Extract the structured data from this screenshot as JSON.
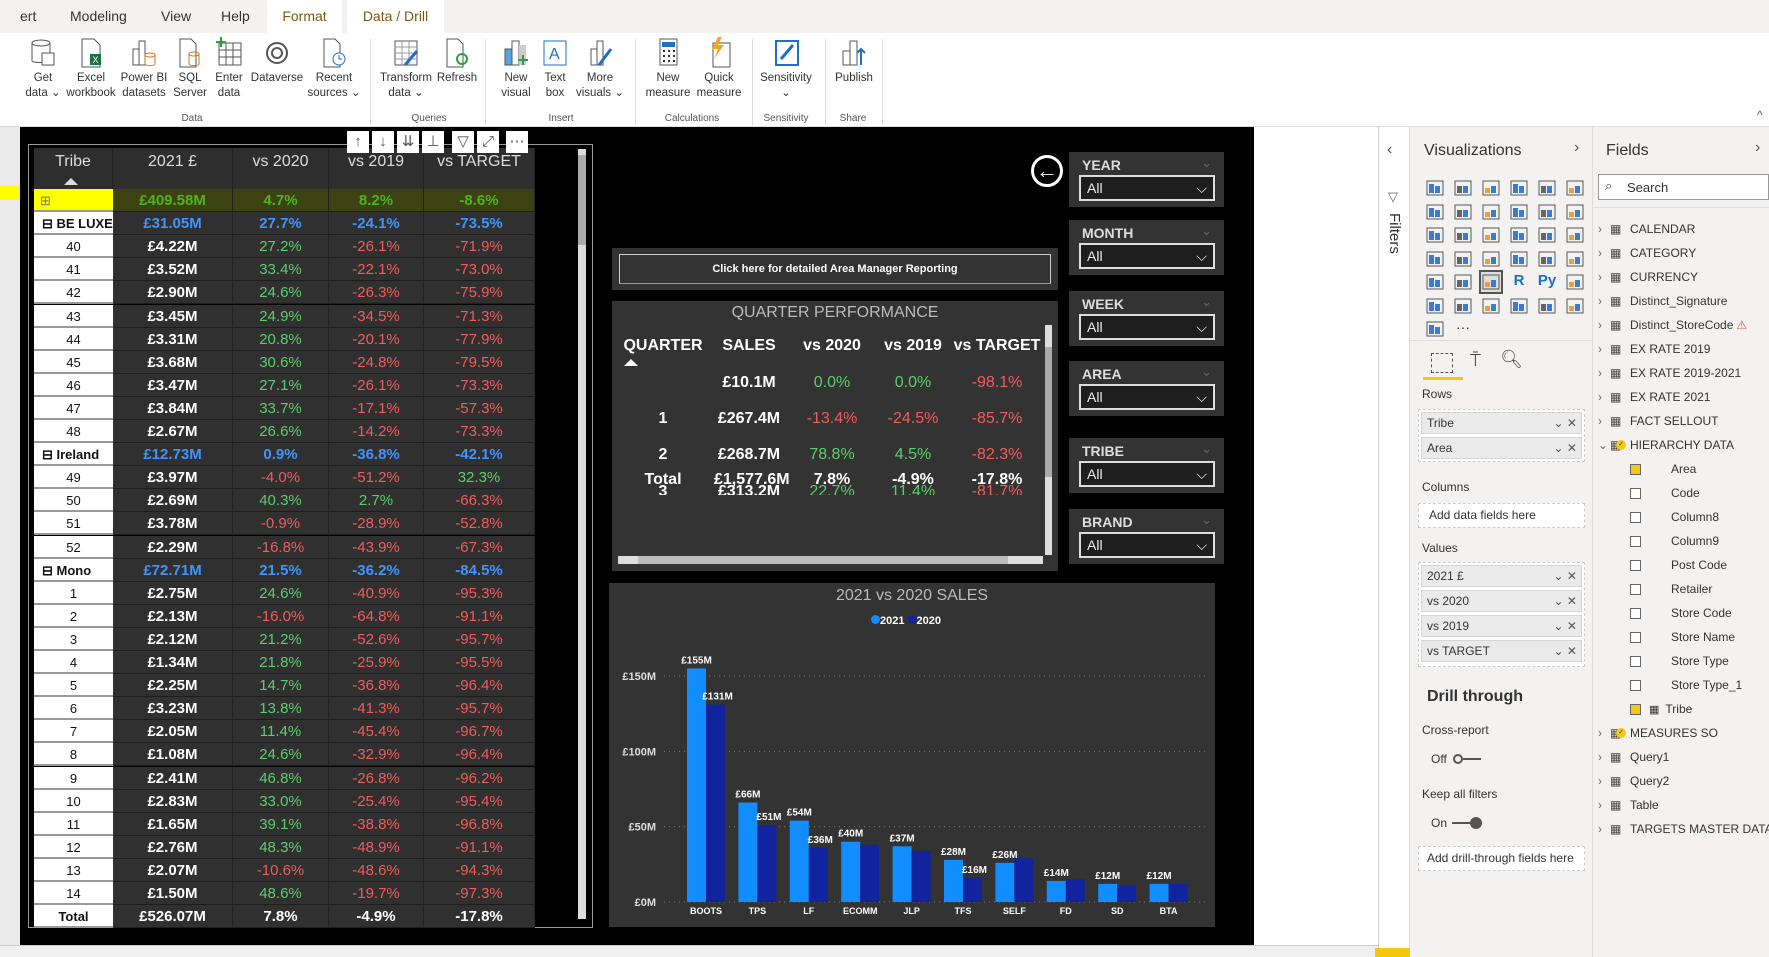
{
  "ribbon": {
    "tabs": [
      {
        "label": "ert"
      },
      {
        "label": "Modeling"
      },
      {
        "label": "View"
      },
      {
        "label": "Help"
      },
      {
        "label": "Format",
        "selected": true
      },
      {
        "label": "Data / Drill",
        "selected": true
      }
    ],
    "buttons": [
      {
        "l1": "Get",
        "l2": "data ⌄",
        "icon": "database-icon"
      },
      {
        "l1": "Excel",
        "l2": "workbook",
        "icon": "excel-icon"
      },
      {
        "l1": "Power BI",
        "l2": "datasets",
        "icon": "powerbi-datasets-icon"
      },
      {
        "l1": "SQL",
        "l2": "Server",
        "icon": "sql-server-icon"
      },
      {
        "l1": "Enter",
        "l2": "data",
        "icon": "enter-data-icon"
      },
      {
        "l1": "Dataverse",
        "l2": "",
        "icon": "dataverse-icon"
      },
      {
        "l1": "Recent",
        "l2": "sources ⌄",
        "icon": "recent-sources-icon"
      },
      {
        "l1": "Transform",
        "l2": "data ⌄",
        "icon": "transform-data-icon"
      },
      {
        "l1": "Refresh",
        "l2": "",
        "icon": "refresh-icon"
      },
      {
        "l1": "New",
        "l2": "visual",
        "icon": "new-visual-icon"
      },
      {
        "l1": "Text",
        "l2": "box",
        "icon": "text-box-icon"
      },
      {
        "l1": "More",
        "l2": "visuals ⌄",
        "icon": "more-visuals-icon"
      },
      {
        "l1": "New",
        "l2": "measure",
        "icon": "new-measure-icon"
      },
      {
        "l1": "Quick",
        "l2": "measure",
        "icon": "quick-measure-icon"
      },
      {
        "l1": "Sensitivity",
        "l2": "⌄",
        "icon": "sensitivity-icon"
      },
      {
        "l1": "Publish",
        "l2": "",
        "icon": "publish-icon"
      }
    ],
    "groups": [
      "Data",
      "Queries",
      "Insert",
      "Calculations",
      "Sensitivity",
      "Share"
    ],
    "collapse": "^"
  },
  "main_table": {
    "headers": [
      "Tribe",
      "2021 £",
      "vs 2020",
      "vs 2019",
      "vs TARGET"
    ],
    "rows": [
      {
        "type": "highlight",
        "tribe": "⊞",
        "v": [
          "£409.58M",
          "4.7%",
          "8.2%",
          "-8.6%"
        ]
      },
      {
        "type": "group",
        "tribe": "⊟  BE LUXE",
        "v": [
          "£31.05M",
          "27.7%",
          "-24.1%",
          "-73.5%"
        ]
      },
      {
        "type": "leaf",
        "tribe": "40",
        "v": [
          "£4.22M",
          "27.2%",
          "-26.1%",
          "-71.9%"
        ]
      },
      {
        "type": "leaf",
        "tribe": "41",
        "v": [
          "£3.52M",
          "33.4%",
          "-22.1%",
          "-73.0%"
        ]
      },
      {
        "type": "leaf",
        "tribe": "42",
        "v": [
          "£2.90M",
          "24.6%",
          "-26.3%",
          "-75.9%"
        ]
      },
      {
        "type": "leaf",
        "tribe": "43",
        "v": [
          "£3.45M",
          "24.9%",
          "-34.5%",
          "-71.3%"
        ]
      },
      {
        "type": "leaf",
        "tribe": "44",
        "v": [
          "£3.31M",
          "20.8%",
          "-20.1%",
          "-77.9%"
        ]
      },
      {
        "type": "leaf",
        "tribe": "45",
        "v": [
          "£3.68M",
          "30.6%",
          "-24.8%",
          "-79.5%"
        ]
      },
      {
        "type": "leaf",
        "tribe": "46",
        "v": [
          "£3.47M",
          "27.1%",
          "-26.1%",
          "-73.3%"
        ]
      },
      {
        "type": "leaf",
        "tribe": "47",
        "v": [
          "£3.84M",
          "33.7%",
          "-17.1%",
          "-57.3%"
        ]
      },
      {
        "type": "leaf",
        "tribe": "48",
        "v": [
          "£2.67M",
          "26.6%",
          "-14.2%",
          "-73.3%"
        ]
      },
      {
        "type": "group",
        "tribe": "⊟  Ireland",
        "v": [
          "£12.73M",
          "0.9%",
          "-36.8%",
          "-42.1%"
        ]
      },
      {
        "type": "leaf",
        "tribe": "49",
        "v": [
          "£3.97M",
          "-4.0%",
          "-51.2%",
          "32.3%"
        ]
      },
      {
        "type": "leaf",
        "tribe": "50",
        "v": [
          "£2.69M",
          "40.3%",
          "2.7%",
          "-66.3%"
        ]
      },
      {
        "type": "leaf",
        "tribe": "51",
        "v": [
          "£3.78M",
          "-0.9%",
          "-28.9%",
          "-52.8%"
        ]
      },
      {
        "type": "leaf",
        "tribe": "52",
        "v": [
          "£2.29M",
          "-16.8%",
          "-43.9%",
          "-67.3%"
        ]
      },
      {
        "type": "group",
        "tribe": "⊟  Mono",
        "v": [
          "£72.71M",
          "21.5%",
          "-36.2%",
          "-84.5%"
        ]
      },
      {
        "type": "leaf",
        "tribe": "1",
        "v": [
          "£2.75M",
          "24.6%",
          "-40.9%",
          "-95.3%"
        ]
      },
      {
        "type": "leaf",
        "tribe": "2",
        "v": [
          "£2.13M",
          "-16.0%",
          "-64.8%",
          "-91.1%"
        ]
      },
      {
        "type": "leaf",
        "tribe": "3",
        "v": [
          "£2.12M",
          "21.2%",
          "-52.6%",
          "-95.7%"
        ]
      },
      {
        "type": "leaf",
        "tribe": "4",
        "v": [
          "£1.34M",
          "21.8%",
          "-25.9%",
          "-95.5%"
        ]
      },
      {
        "type": "leaf",
        "tribe": "5",
        "v": [
          "£2.25M",
          "14.7%",
          "-36.8%",
          "-96.4%"
        ]
      },
      {
        "type": "leaf",
        "tribe": "6",
        "v": [
          "£3.23M",
          "13.8%",
          "-41.3%",
          "-95.7%"
        ]
      },
      {
        "type": "leaf",
        "tribe": "7",
        "v": [
          "£2.05M",
          "11.4%",
          "-45.4%",
          "-96.7%"
        ]
      },
      {
        "type": "leaf",
        "tribe": "8",
        "v": [
          "£1.08M",
          "24.6%",
          "-32.9%",
          "-96.4%"
        ]
      },
      {
        "type": "leaf",
        "tribe": "9",
        "v": [
          "£2.41M",
          "46.8%",
          "-26.8%",
          "-96.2%"
        ]
      },
      {
        "type": "leaf",
        "tribe": "10",
        "v": [
          "£2.83M",
          "33.0%",
          "-25.4%",
          "-95.4%"
        ]
      },
      {
        "type": "leaf",
        "tribe": "11",
        "v": [
          "£1.65M",
          "39.1%",
          "-38.8%",
          "-96.8%"
        ]
      },
      {
        "type": "leaf",
        "tribe": "12",
        "v": [
          "£2.76M",
          "48.3%",
          "-48.9%",
          "-91.1%"
        ]
      },
      {
        "type": "leaf",
        "tribe": "13",
        "v": [
          "£2.07M",
          "-10.6%",
          "-48.6%",
          "-94.3%"
        ]
      },
      {
        "type": "leaf",
        "tribe": "14",
        "v": [
          "£1.50M",
          "48.6%",
          "-19.7%",
          "-97.3%"
        ]
      },
      {
        "type": "total",
        "tribe": "Total",
        "v": [
          "£526.07M",
          "7.8%",
          "-4.9%",
          "-17.8%"
        ]
      }
    ]
  },
  "colors": {
    "positive": "#5ccf6a",
    "negative": "#f25c5c",
    "group": "#3f95ff",
    "highlight": "#4db320",
    "bar2021": "#118dff",
    "bar2020": "#12239e"
  },
  "back_button": {
    "icon": "back-arrow-icon"
  },
  "area_manager_button": "Click here for detailed Area Manager Reporting",
  "quarter": {
    "title": "QUARTER PERFORMANCE",
    "headers": [
      "QUARTER",
      "SALES",
      "vs 2020",
      "vs 2019",
      "vs TARGET"
    ],
    "rows": [
      [
        "",
        "£10.1M",
        "0.0%",
        "0.0%",
        "-98.1%"
      ],
      [
        "1",
        "£267.4M",
        "-13.4%",
        "-24.5%",
        "-85.7%"
      ],
      [
        "2",
        "£268.7M",
        "78.8%",
        "4.5%",
        "-82.3%"
      ],
      [
        "3",
        "£313.2M",
        "22.7%",
        "11.4%",
        "-81.7%"
      ]
    ],
    "total": [
      "Total",
      "£1,577.6M",
      "7.8%",
      "-4.9%",
      "-17.8%"
    ]
  },
  "slicers": [
    {
      "label": "YEAR",
      "value": "All"
    },
    {
      "label": "MONTH",
      "value": "All"
    },
    {
      "label": "WEEK",
      "value": "All"
    },
    {
      "label": "AREA",
      "value": "All"
    },
    {
      "label": "TRIBE",
      "value": "All"
    },
    {
      "label": "BRAND",
      "value": "All"
    }
  ],
  "chart_data": {
    "type": "bar",
    "title": "2021 vs 2020 SALES",
    "categories": [
      "BOOTS",
      "TPS",
      "LF",
      "ECOMM",
      "JLP",
      "TFS",
      "SELF",
      "FD",
      "SD",
      "BTA"
    ],
    "series": [
      {
        "name": "2021",
        "values": [
          155,
          66,
          54,
          40,
          37,
          28,
          26,
          14,
          12,
          12
        ],
        "labels": [
          "£155M",
          "£66M",
          "£54M",
          "£40M",
          "£37M",
          "£28M",
          "£26M",
          "£14M",
          "£12M",
          "£12M"
        ]
      },
      {
        "name": "2020",
        "values": [
          131,
          51,
          36,
          38,
          34,
          16,
          29,
          15,
          11,
          12
        ],
        "labels": [
          "£131M",
          "£51M",
          "£36M",
          "",
          "",
          "£16M",
          "",
          "",
          "",
          ""
        ]
      }
    ],
    "yticks": [
      "£0M",
      "£50M",
      "£100M",
      "£150M"
    ],
    "ylim": [
      0,
      150
    ],
    "grid": true,
    "legend": "top-center"
  },
  "filters_pane": {
    "label": "Filters"
  },
  "viz_pane": {
    "title": "Visualizations",
    "icons": [
      "stacked-bar-icon",
      "stacked-column-icon",
      "clustered-bar-icon",
      "clustered-column-icon",
      "100-stacked-bar-icon",
      "100-stacked-column-icon",
      "line-chart-icon",
      "area-chart-icon",
      "stacked-area-icon",
      "line-column-icon",
      "line-clustered-column-icon",
      "ribbon-chart-icon",
      "waterfall-icon",
      "funnel-icon",
      "scatter-icon",
      "pie-icon",
      "donut-icon",
      "treemap-icon",
      "map-icon",
      "filled-map-icon",
      "gauge-icon",
      "card-icon",
      "multirow-card-icon",
      "kpi-icon",
      "slicer-icon",
      "table-icon",
      "matrix-icon",
      "r-visual-icon",
      "python-visual-icon",
      "key-influencers-icon",
      "decomposition-tree-icon",
      "qna-icon",
      "smart-narrative-icon",
      "paginated-report-icon",
      "arcgis-map-icon",
      "power-apps-icon",
      "power-automate-icon",
      "more-icon"
    ],
    "rows_label": "Rows",
    "rows": [
      "Tribe",
      "Area"
    ],
    "columns_label": "Columns",
    "columns_placeholder": "Add data fields here",
    "values_label": "Values",
    "values": [
      "2021 £",
      "vs 2020",
      "vs 2019",
      "vs TARGET"
    ],
    "drill_title": "Drill through",
    "cross_report": "Cross-report",
    "cross_report_state": "Off",
    "keep_filters": "Keep all filters",
    "keep_filters_state": "On",
    "drill_placeholder": "Add drill-through fields here"
  },
  "fields_pane": {
    "title": "Fields",
    "search_placeholder": "Search",
    "items": [
      {
        "label": "CALENDAR",
        "kind": "table"
      },
      {
        "label": "CATEGORY",
        "kind": "table"
      },
      {
        "label": "CURRENCY",
        "kind": "table"
      },
      {
        "label": "Distinct_Signature",
        "kind": "calc"
      },
      {
        "label": "Distinct_StoreCode",
        "kind": "calc",
        "warning": "⚠"
      },
      {
        "label": "EX RATE 2019",
        "kind": "table"
      },
      {
        "label": "EX RATE 2019-2021",
        "kind": "table"
      },
      {
        "label": "EX RATE 2021",
        "kind": "table"
      },
      {
        "label": "FACT SELLOUT",
        "kind": "table"
      },
      {
        "label": "HIERARCHY DATA",
        "kind": "table",
        "expanded": true,
        "badge": true
      },
      {
        "label": "Area",
        "kind": "field",
        "checked": true
      },
      {
        "label": "Code",
        "kind": "field"
      },
      {
        "label": "Column8",
        "kind": "field"
      },
      {
        "label": "Column9",
        "kind": "field"
      },
      {
        "label": "Post Code",
        "kind": "field"
      },
      {
        "label": "Retailer",
        "kind": "field"
      },
      {
        "label": "Store Code",
        "kind": "field"
      },
      {
        "label": "Store Name",
        "kind": "field"
      },
      {
        "label": "Store Type",
        "kind": "field"
      },
      {
        "label": "Store Type_1",
        "kind": "field"
      },
      {
        "label": "Tribe",
        "kind": "field",
        "checked": true,
        "hier": true
      },
      {
        "label": "MEASURES SO",
        "kind": "calc",
        "badge": true
      },
      {
        "label": "Query1",
        "kind": "table"
      },
      {
        "label": "Query2",
        "kind": "table"
      },
      {
        "label": "Table",
        "kind": "table"
      },
      {
        "label": "TARGETS MASTER DATA",
        "kind": "table"
      }
    ]
  }
}
